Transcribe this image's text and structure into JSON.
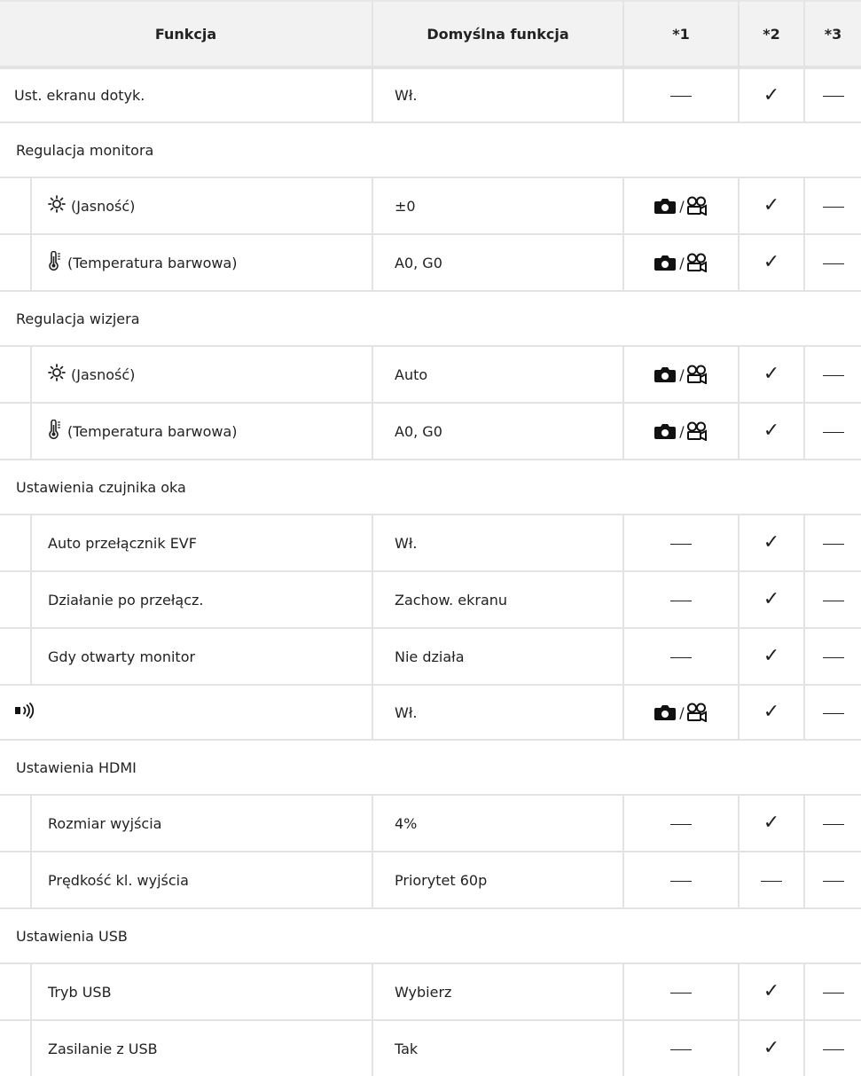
{
  "header": {
    "col_function": "Funkcja",
    "col_default": "Domyślna funkcja",
    "col_n1": "*1",
    "col_n2": "*2",
    "col_n3": "*3"
  },
  "symbols": {
    "dash": "—",
    "check": "✓",
    "slash": "/"
  },
  "rows": {
    "touch": {
      "label": "Ust. ekranu dotyk.",
      "default": "Wł.",
      "n1": "dash",
      "n2": "check",
      "n3": "dash"
    },
    "monitor_section": {
      "label": "Regulacja monitora"
    },
    "monitor_brightness": {
      "label": "(Jasność)",
      "icon": "sun-icon",
      "default": "±0",
      "n1": "photo-video-icon",
      "n2": "check",
      "n3": "dash"
    },
    "monitor_temp": {
      "label": "(Temperatura barwowa)",
      "icon": "thermometer-icon",
      "default": "A0, G0",
      "n1": "photo-video-icon",
      "n2": "check",
      "n3": "dash"
    },
    "viewfinder_section": {
      "label": "Regulacja wizjera"
    },
    "vf_brightness": {
      "label": "(Jasność)",
      "icon": "sun-icon",
      "default": "Auto",
      "n1": "photo-video-icon",
      "n2": "check",
      "n3": "dash"
    },
    "vf_temp": {
      "label": "(Temperatura barwowa)",
      "icon": "thermometer-icon",
      "default": "A0, G0",
      "n1": "photo-video-icon",
      "n2": "check",
      "n3": "dash"
    },
    "eye_section": {
      "label": "Ustawienia czujnika oka"
    },
    "evf_auto": {
      "label": "Auto przełącznik EVF",
      "default": "Wł.",
      "n1": "dash",
      "n2": "check",
      "n3": "dash"
    },
    "after_switch": {
      "label": "Działanie po przełącz.",
      "default": "Zachow. ekranu",
      "n1": "dash",
      "n2": "check",
      "n3": "dash"
    },
    "monitor_open": {
      "label": "Gdy otwarty monitor",
      "default": "Nie działa",
      "n1": "dash",
      "n2": "check",
      "n3": "dash"
    },
    "beep": {
      "label": "",
      "icon": "beep-speaker-icon",
      "default": "Wł.",
      "n1": "photo-video-icon",
      "n2": "check",
      "n3": "dash"
    },
    "hdmi_section": {
      "label": "Ustawienia HDMI"
    },
    "output_size": {
      "label": "Rozmiar wyjścia",
      "default": "4%",
      "n1": "dash",
      "n2": "check",
      "n3": "dash"
    },
    "output_rate": {
      "label": "Prędkość kl. wyjścia",
      "default": "Priorytet 60p",
      "n1": "dash",
      "n2": "dash",
      "n3": "dash"
    },
    "usb_section": {
      "label": "Ustawienia USB"
    },
    "usb_mode": {
      "label": "Tryb USB",
      "default": "Wybierz",
      "n1": "dash",
      "n2": "check",
      "n3": "dash"
    },
    "usb_power": {
      "label": "Zasilanie z USB",
      "default": "Tak",
      "n1": "dash",
      "n2": "check",
      "n3": "dash"
    }
  }
}
